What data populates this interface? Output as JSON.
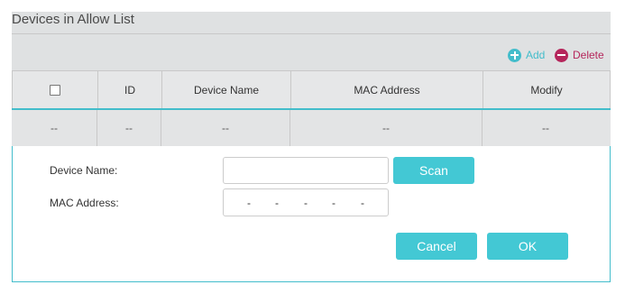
{
  "section": {
    "title": "Devices in Allow List"
  },
  "toolbar": {
    "add_label": "Add",
    "delete_label": "Delete"
  },
  "table": {
    "columns": [
      "ID",
      "Device Name",
      "MAC Address",
      "Modify"
    ],
    "row": [
      "--",
      "--",
      "--",
      "--",
      "--"
    ]
  },
  "form": {
    "device_name_label": "Device Name:",
    "device_name_value": "",
    "mac_label": "MAC Address:",
    "mac_separators": [
      "-",
      "-",
      "-",
      "-",
      "-"
    ],
    "scan_label": "Scan",
    "cancel_label": "Cancel",
    "ok_label": "OK"
  },
  "colors": {
    "accent": "#43c8d4",
    "delete": "#b5265b",
    "header_bg": "#dfe1e2"
  }
}
